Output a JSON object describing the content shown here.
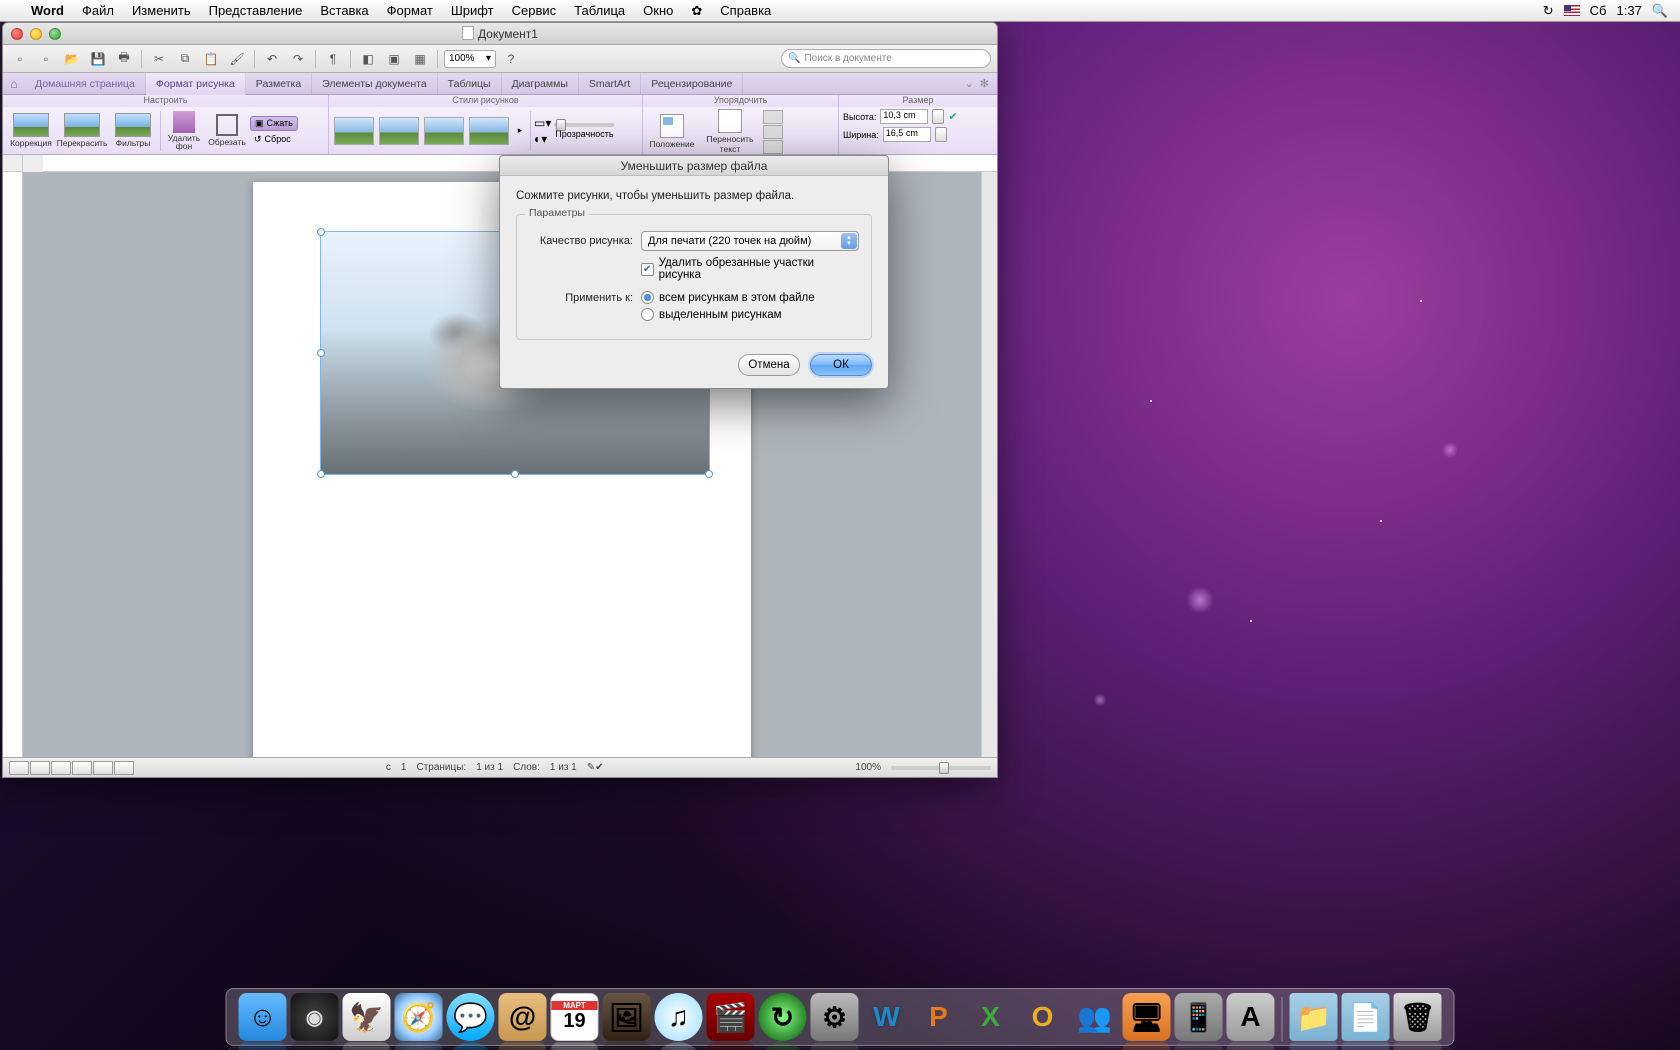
{
  "menubar": {
    "app": "Word",
    "items": [
      "Файл",
      "Изменить",
      "Представление",
      "Вставка",
      "Формат",
      "Шрифт",
      "Сервис",
      "Таблица",
      "Окно",
      "Справка"
    ],
    "weekday": "Сб",
    "time": "1:37",
    "scriptmenu": "✿"
  },
  "window": {
    "title": "Документ1",
    "search_placeholder": "Поиск в документе",
    "zoom": "100%"
  },
  "ribbon": {
    "home": "Домашняя страница",
    "tabs": [
      "Формат рисунка",
      "Разметка",
      "Элементы документа",
      "Таблицы",
      "Диаграммы",
      "SmartArt",
      "Рецензирование"
    ],
    "groups": {
      "adjust": "Настроить",
      "styles": "Стили рисунков",
      "arrange": "Упорядочить",
      "size": "Размер"
    },
    "adjust_buttons": {
      "corrections": "Коррекция",
      "recolor": "Перекрасить",
      "filters": "Фильтры",
      "removebg": "Удалить\nфон",
      "crop": "Обрезать",
      "compress": "Сжать",
      "reset": "Сброс"
    },
    "transparency": "Прозрачность",
    "position": "Положение",
    "wrap": "Переносить текст",
    "height_label": "Высота:",
    "width_label": "Ширина:",
    "height_val": "10,3 cm",
    "width_val": "16,5 cm"
  },
  "statusbar": {
    "sec": "с",
    "sec_val": "1",
    "pages": "Страницы:",
    "pages_val": "1 из 1",
    "words": "Слов:",
    "words_val": "1 из 1",
    "zoom": "100%"
  },
  "dialog": {
    "title": "Уменьшить размер файла",
    "message": "Сожмите рисунки, чтобы уменьшить размер файла.",
    "group": "Параметры",
    "quality_label": "Качество рисунка:",
    "quality_value": "Для печати (220 точек на дюйм)",
    "delete_cropped": "Удалить обрезанные участки рисунка",
    "apply_label": "Применить к:",
    "apply_all": "всем рисункам в этом файле",
    "apply_selected": "выделенным рисункам",
    "cancel": "Отмена",
    "ok": "ОК"
  },
  "dock": [
    "Finder",
    "Dashboard",
    "Mail",
    "Safari",
    "iChat",
    "Address",
    "iCal",
    "iPhoto",
    "iTunes",
    "Recorder",
    "TimeMachine",
    "AppStore",
    "Preferences",
    "Word",
    "PowerPoint",
    "Excel",
    "Outlook",
    "Messenger",
    "RemoteDesktop",
    "Communicator",
    "AppStore2",
    "Documents",
    "Downloads",
    "Trash"
  ]
}
